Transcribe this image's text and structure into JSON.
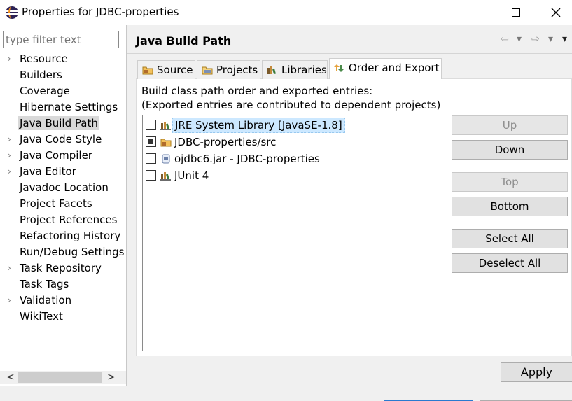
{
  "window": {
    "title": "Properties for JDBC-properties",
    "minimize": "minimize",
    "maximize": "maximize",
    "close": "close"
  },
  "filter": {
    "placeholder": "type filter text"
  },
  "tree": {
    "items": [
      {
        "label": "Resource",
        "expandable": true
      },
      {
        "label": "Builders",
        "expandable": false
      },
      {
        "label": "Coverage",
        "expandable": false
      },
      {
        "label": "Hibernate Settings",
        "expandable": false
      },
      {
        "label": "Java Build Path",
        "expandable": false,
        "selected": true
      },
      {
        "label": "Java Code Style",
        "expandable": true
      },
      {
        "label": "Java Compiler",
        "expandable": true
      },
      {
        "label": "Java Editor",
        "expandable": true
      },
      {
        "label": "Javadoc Location",
        "expandable": false
      },
      {
        "label": "Project Facets",
        "expandable": false
      },
      {
        "label": "Project References",
        "expandable": false
      },
      {
        "label": "Refactoring History",
        "expandable": false
      },
      {
        "label": "Run/Debug Settings",
        "expandable": false
      },
      {
        "label": "Task Repository",
        "expandable": true
      },
      {
        "label": "Task Tags",
        "expandable": false
      },
      {
        "label": "Validation",
        "expandable": true
      },
      {
        "label": "WikiText",
        "expandable": false
      }
    ]
  },
  "page": {
    "title": "Java Build Path"
  },
  "nav": {
    "back": "⇦",
    "back_menu": "▾",
    "forward": "⇨",
    "forward_menu": "▾",
    "view_menu": "▾"
  },
  "tabs": [
    {
      "label": "Source",
      "icon": "source-folder-icon"
    },
    {
      "label": "Projects",
      "icon": "projects-icon"
    },
    {
      "label": "Libraries",
      "icon": "libraries-icon"
    },
    {
      "label": "Order and Export",
      "icon": "order-export-icon",
      "active": true
    }
  ],
  "order_export": {
    "description_line1": "Build class path order and exported entries:",
    "description_line2": "(Exported entries are contributed to dependent projects)",
    "entries": [
      {
        "label": "JRE System Library [JavaSE-1.8]",
        "checked": false,
        "selected": true,
        "icon": "library-icon"
      },
      {
        "label": "JDBC-properties/src",
        "checked": true,
        "selected": false,
        "icon": "source-folder-icon"
      },
      {
        "label": "ojdbc6.jar - JDBC-properties",
        "checked": false,
        "selected": false,
        "icon": "jar-icon"
      },
      {
        "label": "JUnit 4",
        "checked": false,
        "selected": false,
        "icon": "library-icon"
      }
    ],
    "buttons": {
      "up": "Up",
      "down": "Down",
      "top": "Top",
      "bottom": "Bottom",
      "select_all": "Select All",
      "deselect_all": "Deselect All"
    }
  },
  "apply": "Apply",
  "colors": {
    "selection": "#cce8ff",
    "tree_selection": "#d9d9d9",
    "button_face": "#e1e1e1",
    "pane_bg": "#f0f0f0",
    "accent": "#2a7ad0"
  }
}
